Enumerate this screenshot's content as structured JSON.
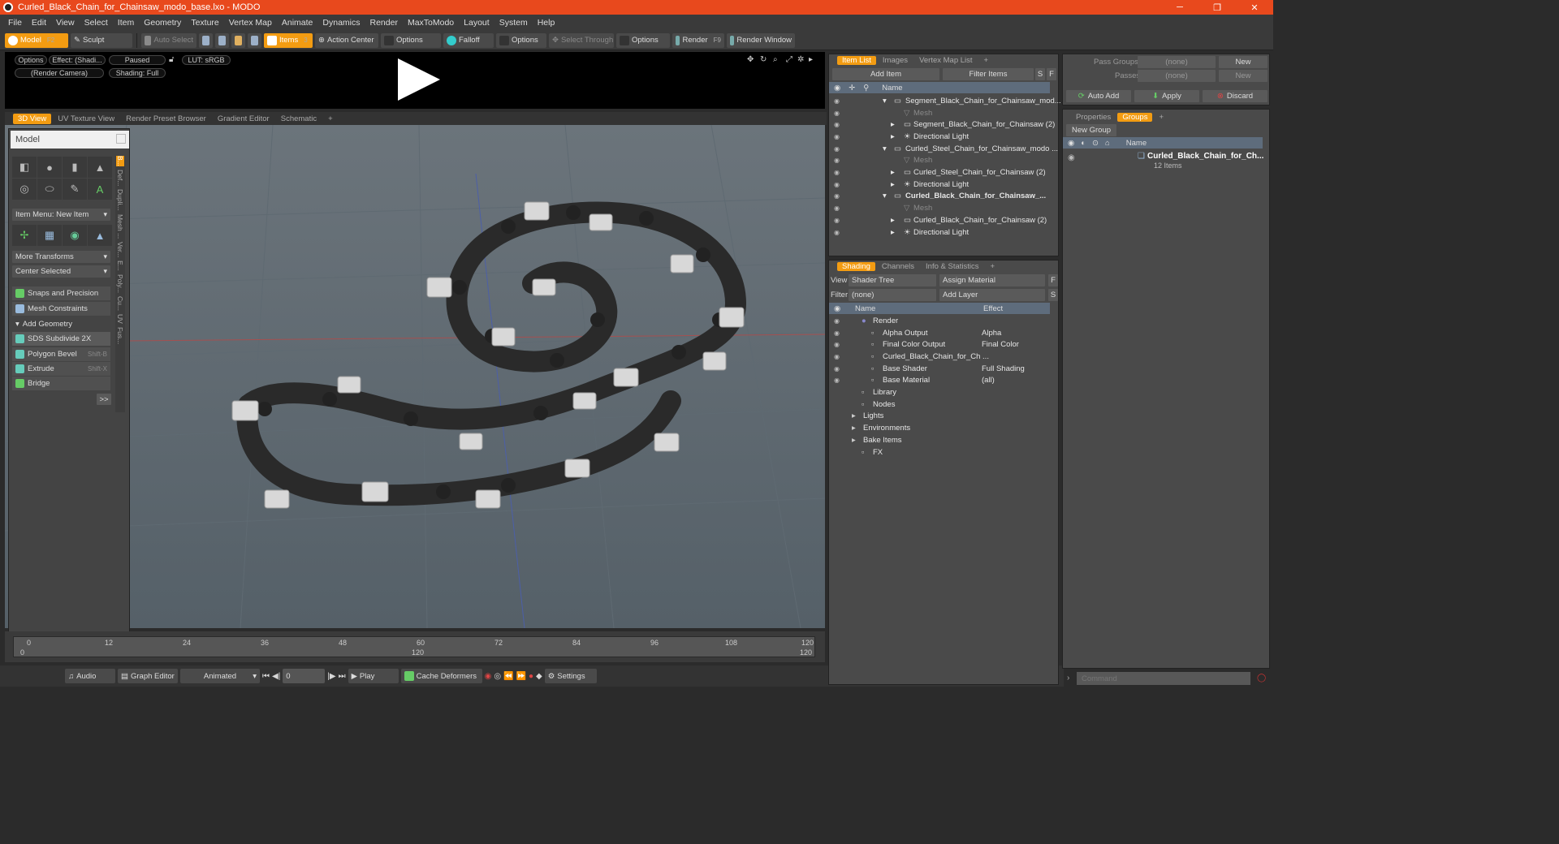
{
  "window": {
    "title": "Curled_Black_Chain_for_Chainsaw_modo_base.lxo - MODO",
    "minimize": "─",
    "maximize": "❐",
    "close": "✕"
  },
  "menu": [
    "File",
    "Edit",
    "View",
    "Select",
    "Item",
    "Geometry",
    "Texture",
    "Vertex Map",
    "Animate",
    "Dynamics",
    "Render",
    "MaxToModo",
    "Layout",
    "System",
    "Help"
  ],
  "toolbar": {
    "model": "Model",
    "model_key": "F2",
    "sculpt": "Sculpt",
    "auto_select": "Auto Select",
    "items": "Items",
    "items_key": "3",
    "action_center": "Action Center",
    "options1": "Options",
    "falloff": "Falloff",
    "options2": "Options",
    "select_through": "Select Through",
    "options3": "Options",
    "render": "Render",
    "render_key": "F9",
    "render_window": "Render Window"
  },
  "anim_bar": {
    "options": "Options",
    "effect": "Effect: (Shadi...",
    "paused": "Paused",
    "lut": "LUT: sRGB",
    "camera": "(Render Camera)",
    "shading": "Shading: Full"
  },
  "viewport_tabs": [
    "3D View",
    "UV Texture View",
    "Render Preset Browser",
    "Gradient Editor",
    "Schematic",
    "+"
  ],
  "model_panel": {
    "title": "Model",
    "item_menu": "Item Menu: New Item",
    "more_transforms": "More Transforms",
    "center_selected": "Center Selected",
    "snaps": "Snaps and Precision",
    "mesh_constraints": "Mesh Constraints",
    "add_geometry": "Add Geometry",
    "sds": "SDS Subdivide 2X",
    "polygon_bevel": "Polygon Bevel",
    "polygon_bevel_key": "Shift-B",
    "extrude": "Extrude",
    "extrude_key": "Shift-X",
    "bridge": "Bridge",
    "more": ">>",
    "side_tabs": [
      "B...",
      "Def...",
      "Dupli...",
      "Mesh ...",
      "Ver...",
      "E...",
      "Poly...",
      "Cu...",
      "UV",
      "Fus..."
    ]
  },
  "timeline": {
    "ticks": [
      "0",
      "12",
      "24",
      "36",
      "48",
      "60",
      "72",
      "84",
      "96",
      "108",
      "120"
    ],
    "start": "0",
    "mid": "120",
    "end": "120"
  },
  "bottom": {
    "audio": "Audio",
    "graph_editor": "Graph Editor",
    "animated": "Animated",
    "frame": "0",
    "play": "Play",
    "cache": "Cache Deformers",
    "settings": "Settings"
  },
  "item_list": {
    "tabs": [
      "Item List",
      "Images",
      "Vertex Map List",
      "+"
    ],
    "add_item": "Add Item",
    "filter": "Filter Items",
    "s": "S",
    "f": "F",
    "col_name": "Name",
    "rows": [
      {
        "label": "Segment_Black_Chain_for_Chainsaw_mod...",
        "indent": 0,
        "bold": false,
        "dim": false
      },
      {
        "label": "Mesh",
        "indent": 1,
        "bold": false,
        "dim": true
      },
      {
        "label": "Segment_Black_Chain_for_Chainsaw (2)",
        "indent": 1,
        "bold": false,
        "dim": false
      },
      {
        "label": "Directional Light",
        "indent": 1,
        "bold": false,
        "dim": false
      },
      {
        "label": "Curled_Steel_Chain_for_Chainsaw_modo ...",
        "indent": 0,
        "bold": false,
        "dim": false
      },
      {
        "label": "Mesh",
        "indent": 1,
        "bold": false,
        "dim": true
      },
      {
        "label": "Curled_Steel_Chain_for_Chainsaw (2)",
        "indent": 1,
        "bold": false,
        "dim": false
      },
      {
        "label": "Directional Light",
        "indent": 1,
        "bold": false,
        "dim": false
      },
      {
        "label": "Curled_Black_Chain_for_Chainsaw_...",
        "indent": 0,
        "bold": true,
        "dim": false
      },
      {
        "label": "Mesh",
        "indent": 1,
        "bold": false,
        "dim": true
      },
      {
        "label": "Curled_Black_Chain_for_Chainsaw (2)",
        "indent": 1,
        "bold": false,
        "dim": false
      },
      {
        "label": "Directional Light",
        "indent": 1,
        "bold": false,
        "dim": false
      }
    ]
  },
  "shading": {
    "tabs": [
      "Shading",
      "Channels",
      "Info & Statistics",
      "+"
    ],
    "view_label": "View",
    "view_value": "Shader Tree",
    "assign": "Assign Material",
    "f": "F",
    "filter_label": "Filter",
    "filter_value": "(none)",
    "add_layer": "Add Layer",
    "s": "S",
    "col_name": "Name",
    "col_effect": "Effect",
    "rows": [
      {
        "label": "Render",
        "effect": "",
        "indent": 0
      },
      {
        "label": "Alpha Output",
        "effect": "Alpha",
        "indent": 1
      },
      {
        "label": "Final Color Output",
        "effect": "Final Color",
        "indent": 1
      },
      {
        "label": "Curled_Black_Chain_for_Ch ...",
        "effect": "",
        "indent": 1
      },
      {
        "label": "Base Shader",
        "effect": "Full Shading",
        "indent": 1
      },
      {
        "label": "Base Material",
        "effect": "(all)",
        "indent": 1
      },
      {
        "label": "Library",
        "effect": "",
        "indent": 0
      },
      {
        "label": "Nodes",
        "effect": "",
        "indent": 0
      },
      {
        "label": "Lights",
        "effect": "",
        "indent": -1
      },
      {
        "label": "Environments",
        "effect": "",
        "indent": -1
      },
      {
        "label": "Bake Items",
        "effect": "",
        "indent": -1
      },
      {
        "label": "FX",
        "effect": "",
        "indent": 0
      }
    ]
  },
  "pass": {
    "pass_groups": "Pass Groups",
    "passes": "Passes",
    "none1": "(none)",
    "none2": "(none)",
    "new1": "New",
    "new2": "New",
    "auto_add": "Auto Add",
    "apply": "Apply",
    "discard": "Discard"
  },
  "groups": {
    "tabs": [
      "Properties",
      "Groups",
      "+"
    ],
    "new_group": "New Group",
    "col_name": "Name",
    "item": "Curled_Black_Chain_for_Ch...",
    "count": "12 Items"
  },
  "command": {
    "placeholder": "Command"
  },
  "colors": {
    "accent": "#f39c12",
    "title": "#e8491d"
  }
}
